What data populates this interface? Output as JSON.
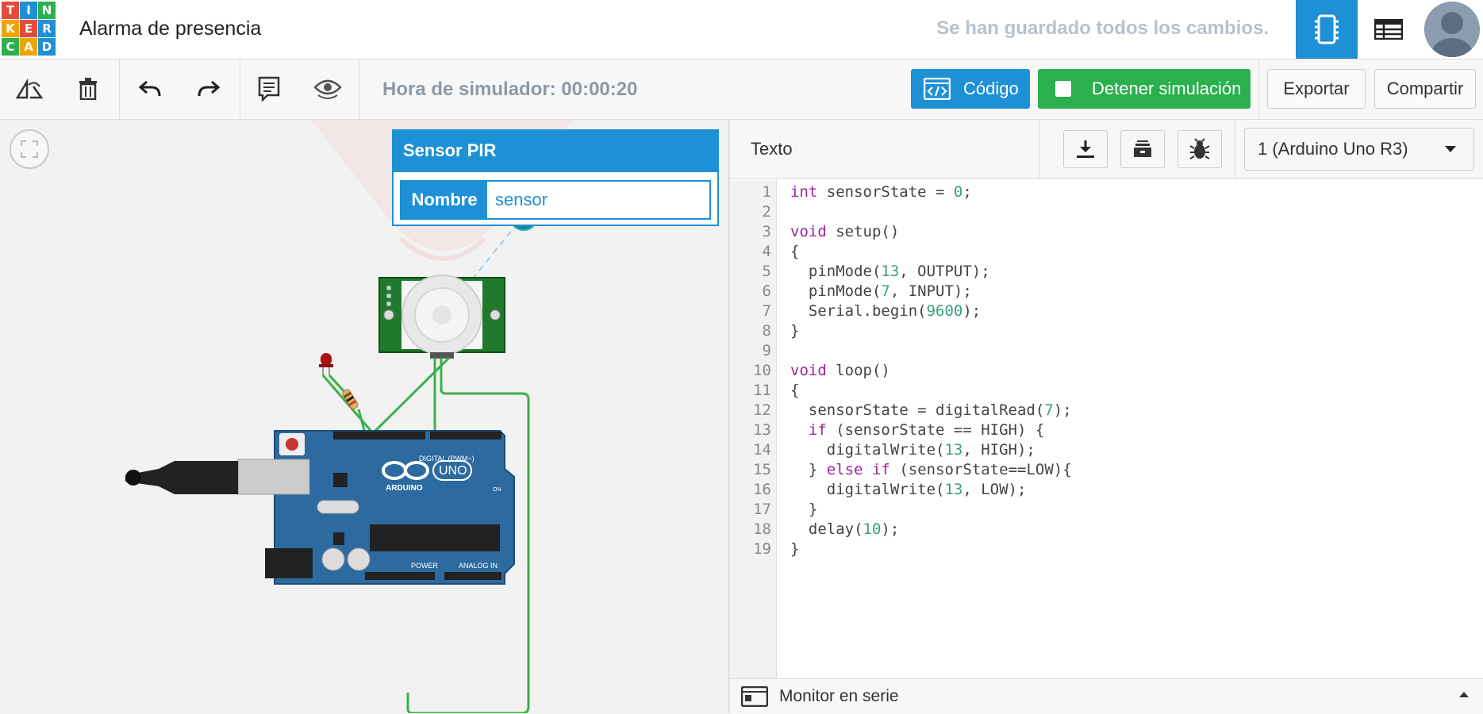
{
  "app": {
    "logo_letters": [
      "T",
      "I",
      "N",
      "K",
      "E",
      "R",
      "C",
      "A",
      "D"
    ],
    "logo_colors": [
      "#e54b3a",
      "#1e90d6",
      "#2ab04d",
      "#f0a400",
      "#e54b3a",
      "#1e90d6",
      "#2ab04d",
      "#f0a400",
      "#1e90d6"
    ],
    "project_title": "Alarma de presencia",
    "save_status": "Se han guardado todos los cambios."
  },
  "toolbar": {
    "sim_time": "Hora de simulador: 00:00:20",
    "code_label": "Código",
    "stop_label": "Detener simulación",
    "export_label": "Exportar",
    "share_label": "Compartir",
    "icons": [
      "rotate-icon",
      "trash-icon",
      "undo-icon",
      "redo-icon",
      "notes-icon",
      "visibility-icon"
    ]
  },
  "inspector": {
    "title": "Sensor PIR",
    "field_label": "Nombre",
    "field_value": "sensor"
  },
  "code_panel": {
    "mode_label": "Texto",
    "board": "1 (Arduino Uno R3)",
    "serial_monitor": "Monitor en serie",
    "line_numbers": [
      "1",
      "2",
      "3",
      "4",
      "5",
      "6",
      "7",
      "8",
      "9",
      "10",
      "11",
      "12",
      "13",
      "14",
      "15",
      "16",
      "17",
      "18",
      "19"
    ],
    "lines": [
      "int sensorState = 0;",
      "",
      "void setup()",
      "{",
      "  pinMode(13, OUTPUT);",
      "  pinMode(7, INPUT);",
      "  Serial.begin(9600);",
      "}",
      "",
      "void loop()",
      "{",
      "  sensorState = digitalRead(7);",
      "  if (sensorState == HIGH) {",
      "    digitalWrite(13, HIGH);",
      "  } else if (sensorState==LOW){",
      "    digitalWrite(13, LOW);",
      "  }",
      "  delay(10);",
      "}"
    ]
  },
  "board": {
    "label_arduino": "ARDUINO",
    "label_uno": "UNO",
    "label_digital": "DIGITAL (PWM~)",
    "label_power": "POWER",
    "label_analog": "ANALOG IN",
    "label_on": "ON"
  },
  "colors": {
    "accent": "#1e90d6",
    "stop": "#2ab04d",
    "wire": "#3db04a",
    "board": "#2c6aa0"
  }
}
